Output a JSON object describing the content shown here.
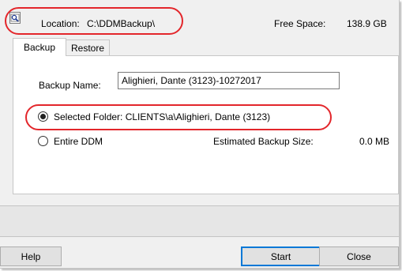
{
  "header": {
    "location_label": "Location:",
    "location_value": "C:\\DDMBackup\\",
    "free_space_label": "Free Space:",
    "free_space_value": "138.9 GB",
    "location_icon": "folder-search-icon"
  },
  "tabs": [
    {
      "label": "Backup",
      "active": true
    },
    {
      "label": "Restore",
      "active": false
    }
  ],
  "backup": {
    "name_label": "Backup Name:",
    "name_value": "Alighieri, Dante (3123)-10272017",
    "selected_folder_label": "Selected Folder: CLIENTS\\a\\Alighieri, Dante (3123)",
    "selected_folder_checked": true,
    "entire_ddm_label": "Entire DDM",
    "entire_ddm_checked": false,
    "estimated_size_label": "Estimated Backup Size:",
    "estimated_size_value": "0.0 MB"
  },
  "buttons": {
    "help": "Help",
    "start": "Start",
    "close": "Close"
  },
  "annotation_color": "#e3262b"
}
